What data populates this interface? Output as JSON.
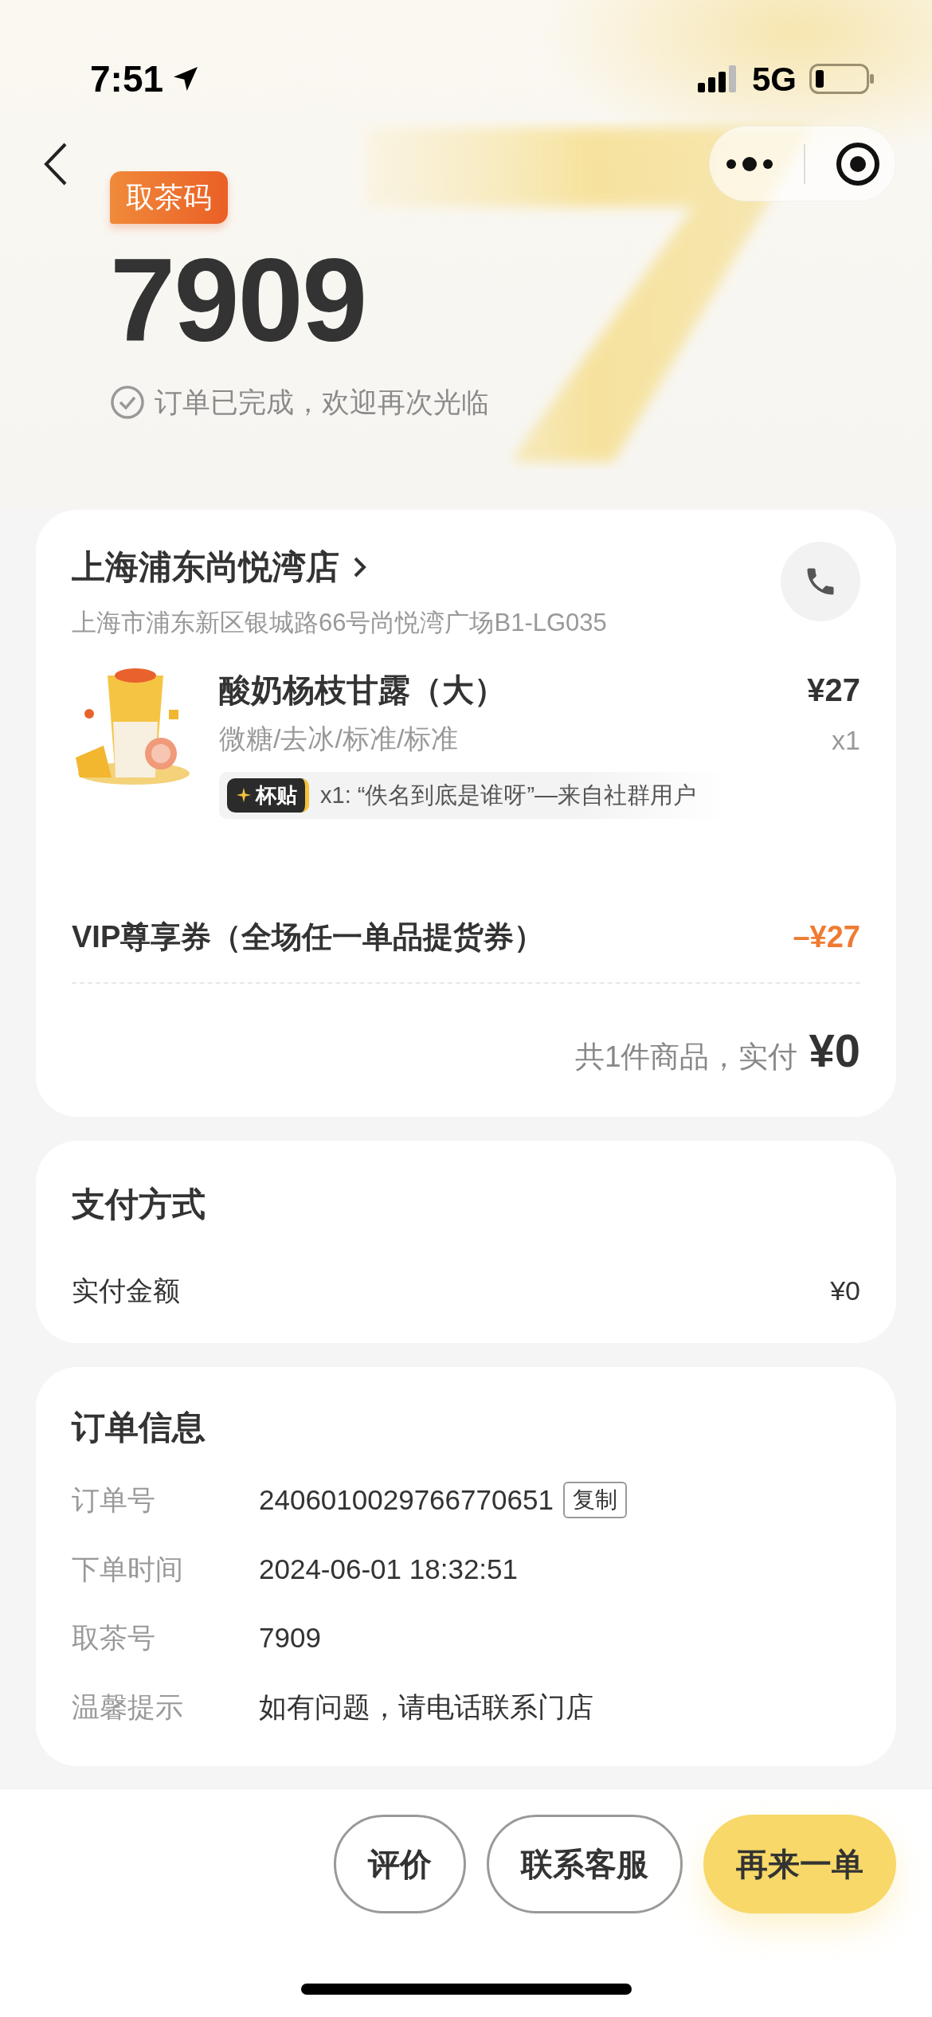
{
  "status_bar": {
    "time": "7:51",
    "network": "5G"
  },
  "pickup": {
    "badge": "取茶码",
    "code": "7909",
    "status": "订单已完成，欢迎再次光临"
  },
  "store": {
    "name": "上海浦东尚悦湾店",
    "address": "上海市浦东新区银城路66号尚悦湾广场B1-LG035"
  },
  "items": [
    {
      "name": "酸奶杨枝甘露（大）",
      "options": "微糖/去冰/标准/标准",
      "price": "¥27",
      "quantity": "x1",
      "sticker": {
        "label": "杯贴",
        "text": "x1: “佚名到底是谁呀”—来自社群用户"
      }
    }
  ],
  "coupon": {
    "name": "VIP尊享券（全场任一单品提货券）",
    "amount": "–¥27"
  },
  "total": {
    "label": "共1件商品，实付",
    "amount": "¥0"
  },
  "payment": {
    "title": "支付方式",
    "rows": [
      {
        "label": "实付金额",
        "value": "¥0"
      }
    ]
  },
  "order_info": {
    "title": "订单信息",
    "rows": [
      {
        "label": "订单号",
        "value": "2406010029766770651",
        "action": "复制"
      },
      {
        "label": "下单时间",
        "value": "2024-06-01 18:32:51"
      },
      {
        "label": "取茶号",
        "value": "7909"
      },
      {
        "label": "温馨提示",
        "value": "如有问题，请电话联系门店"
      }
    ]
  },
  "actions": [
    {
      "label": "评价",
      "kind": "outline"
    },
    {
      "label": "联系客服",
      "kind": "outline"
    },
    {
      "label": "再来一单",
      "kind": "primary"
    }
  ]
}
